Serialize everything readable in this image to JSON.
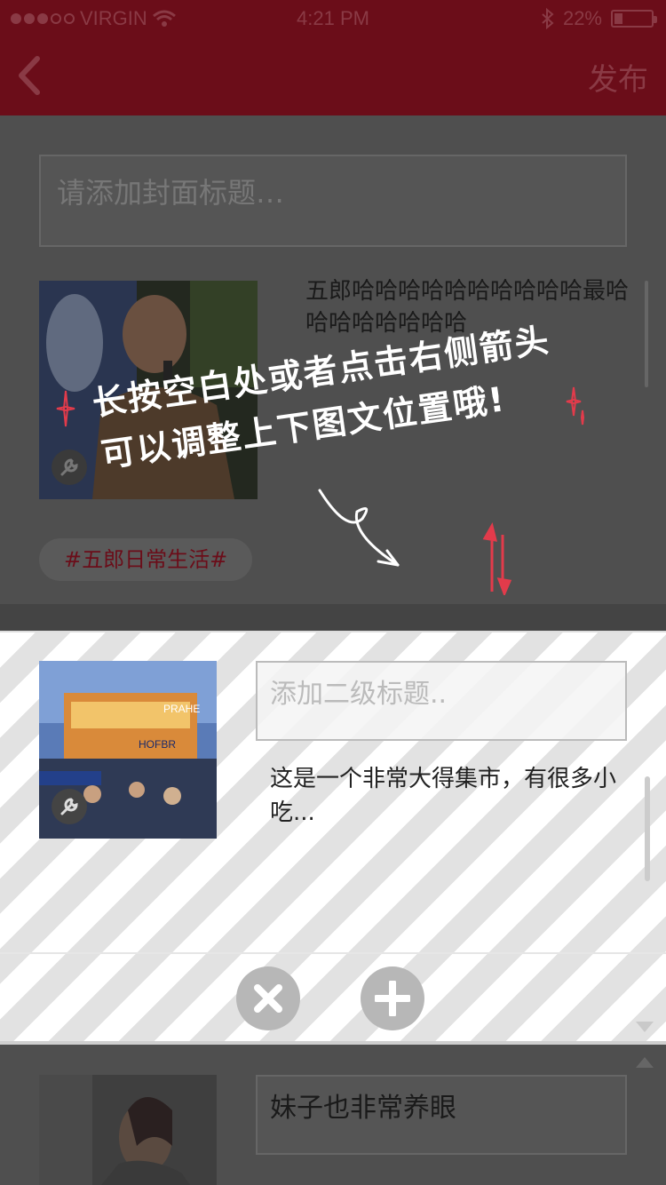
{
  "status_bar": {
    "carrier": "VIRGIN",
    "time": "4:21 PM",
    "battery": "22%",
    "battery_level": 0.22
  },
  "nav": {
    "back_icon": "chevron-left-icon",
    "publish_label": "发布"
  },
  "cover": {
    "title_placeholder": "请添加封面标题…"
  },
  "sections": [
    {
      "description": "五郎哈哈哈哈哈哈哈哈哈哈最哈哈哈哈哈哈哈哈",
      "image_icon": "wrench-icon"
    },
    {
      "subtitle_placeholder": "添加二级标题..",
      "description": "这是一个非常大得集市，有很多小吃...",
      "image_icon": "wrench-icon",
      "image_signs": [
        "HOFBR",
        "PRAHE"
      ]
    },
    {
      "title": "妹子也非常养眼"
    }
  ],
  "tag": "#五郎日常生活#",
  "hint": {
    "line1": "长按空白处或者点击右侧箭头",
    "line2": "可以调整上下图文位置哦!"
  },
  "actions": {
    "delete_icon": "close-icon",
    "add_icon": "plus-icon"
  },
  "colors": {
    "brand": "#6b0d19",
    "accent_red": "#e23b4b"
  }
}
